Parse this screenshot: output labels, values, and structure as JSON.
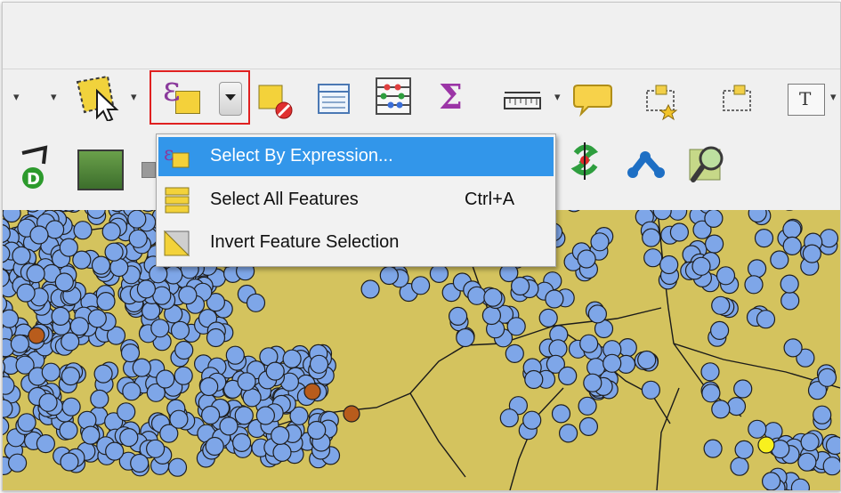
{
  "menu": {
    "items": [
      {
        "label": "Select By Expression...",
        "shortcut": ""
      },
      {
        "label": "Select All Features",
        "shortcut": "Ctrl+A"
      },
      {
        "label": "Invert Feature Selection",
        "shortcut": ""
      }
    ]
  },
  "toolbar": {
    "sum_glyph": "Σ",
    "expression_glyph": "ε",
    "text_glyph": "T"
  },
  "colors": {
    "map_background": "#d4c35e",
    "point_fill": "#7ea6e8",
    "highlight": "#3296ea",
    "outline_box": "#e02020"
  }
}
